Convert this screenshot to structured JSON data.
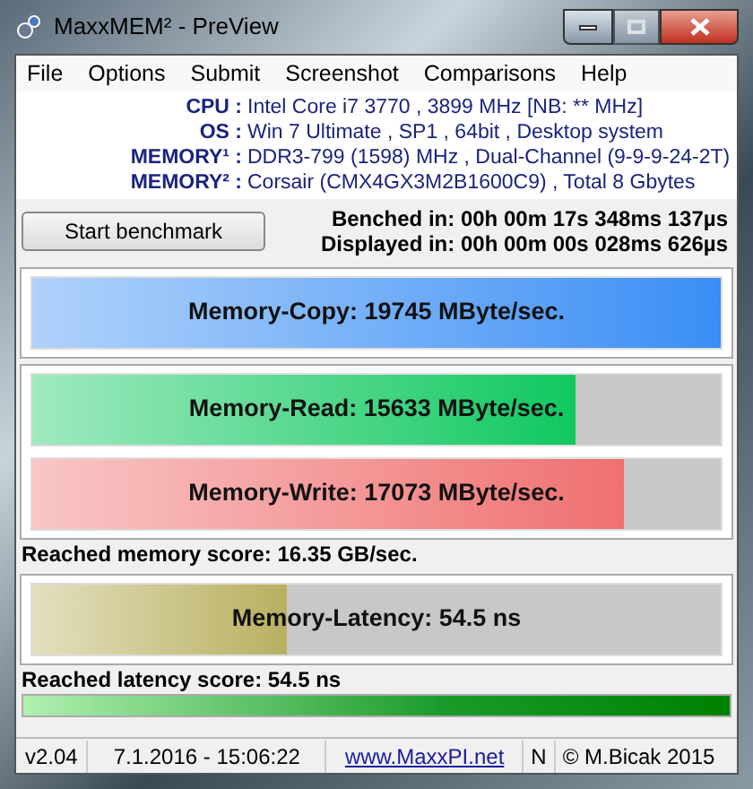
{
  "window": {
    "title": "MaxxMEM² - PreView"
  },
  "menu": [
    "File",
    "Options",
    "Submit",
    "Screenshot",
    "Comparisons",
    "Help"
  ],
  "info": [
    {
      "label": "CPU :",
      "value": "Intel Core i7 3770 , 3899 MHz  [NB: ** MHz]"
    },
    {
      "label": "OS :",
      "value": "Win 7 Ultimate , SP1 , 64bit , Desktop system"
    },
    {
      "label": "MEMORY¹ :",
      "value": "DDR3-799 (1598) MHz , Dual-Channel (9-9-9-24-2T)"
    },
    {
      "label": "MEMORY² :",
      "value": "Corsair (CMX4GX3M2B1600C9) , Total 8 Gbytes"
    }
  ],
  "start_button": "Start benchmark",
  "timings": [
    "Benched in: 00h 00m 17s 348ms 137µs",
    "Displayed in: 00h 00m 00s 028ms 626µs"
  ],
  "groups": [
    {
      "bars": [
        {
          "text": "Memory-Copy: 19745 MByte/sec.",
          "level": 1.0,
          "color": "#3a8ef5"
        }
      ]
    },
    {
      "bars": [
        {
          "text": "Memory-Read: 15633 MByte/sec.",
          "level": 0.79,
          "color": "#10c860"
        },
        {
          "text": "Memory-Write: 17073 MByte/sec.",
          "level": 0.86,
          "color": "#f07070"
        }
      ],
      "score": "Reached memory score: 16.35 GB/sec."
    },
    {
      "bars": [
        {
          "text": "Memory-Latency: 54.5 ns",
          "level": 0.37,
          "color": "#b8b060"
        }
      ],
      "score": "Reached latency score: 54.5 ns"
    }
  ],
  "score_bar": {
    "level": 1.0
  },
  "status_bar": {
    "version": "v2.04",
    "datetime": "7.1.2016 - 15:06:22",
    "link": "www.MaxxPI.net",
    "flag": "N",
    "copyright": "© M.Bicak 2015"
  }
}
